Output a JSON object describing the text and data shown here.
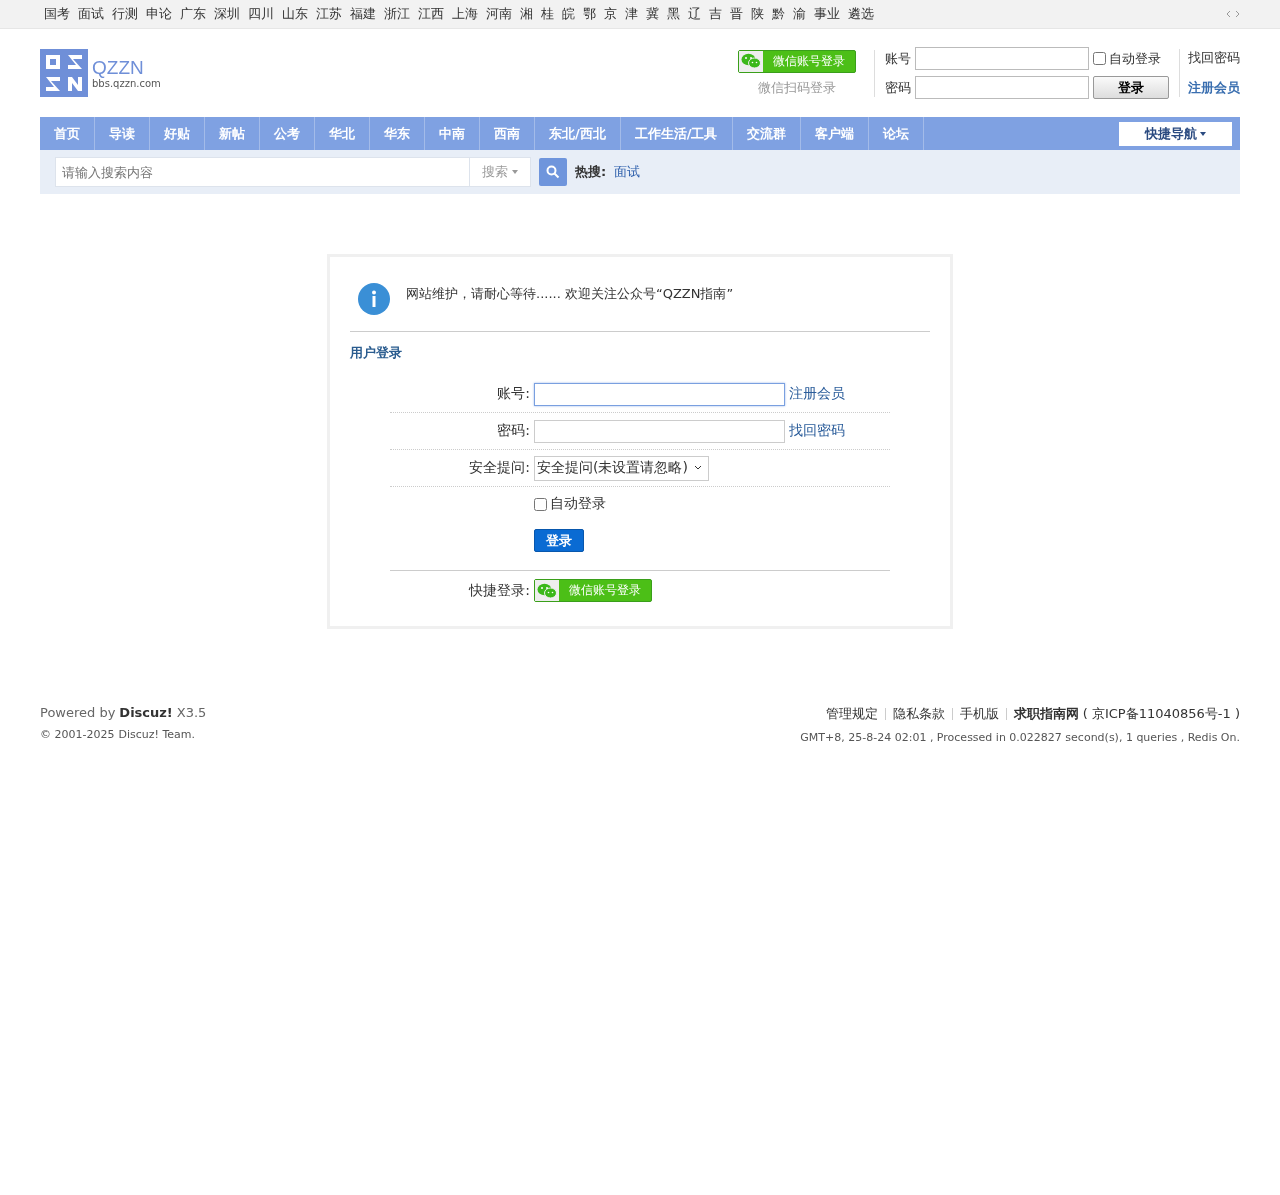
{
  "top_links": [
    "国考",
    "面试",
    "行测",
    "申论",
    "广东",
    "深圳",
    "四川",
    "山东",
    "江苏",
    "福建",
    "浙江",
    "江西",
    "上海",
    "河南",
    "湘",
    "桂",
    "皖",
    "鄂",
    "京",
    "津",
    "冀",
    "黑",
    "辽",
    "吉",
    "晋",
    "陕",
    "黔",
    "渝",
    "事业",
    "遴选"
  ],
  "logo": {
    "name": "QZZN",
    "domain": "bbs.qzzn.com"
  },
  "header_login": {
    "wechat_button": "微信账号登录",
    "wechat_hint": "微信扫码登录",
    "account_label": "账号",
    "password_label": "密码",
    "auto_login": {
      "label": "自动登录",
      "checked": false
    },
    "login_button": "登录",
    "forgot_link": "找回密码",
    "register_link": "注册会员"
  },
  "nav": {
    "items": [
      "首页",
      "导读",
      "好贴",
      "新帖",
      "公考",
      "华北",
      "华东",
      "中南",
      "西南",
      "东北/西北",
      "工作生活/工具",
      "交流群",
      "客户端",
      "论坛"
    ],
    "quick_nav": "快捷导航"
  },
  "search": {
    "placeholder": "请输入搜索内容",
    "type": "搜索",
    "hot_label": "热搜:",
    "hot_links": [
      "面试"
    ]
  },
  "notice": "网站维护，请耐心等待...... 欢迎关注公众号“QZZN指南”",
  "login_form": {
    "title": "用户登录",
    "rows": [
      {
        "kind": "input",
        "label": "账号:",
        "link": "注册会员",
        "focused": true
      },
      {
        "kind": "input",
        "label": "密码:",
        "link": "找回密码",
        "focused": false
      },
      {
        "kind": "select",
        "label": "安全提问:",
        "value": "安全提问(未设置请忽略)"
      }
    ],
    "auto_login": {
      "label": "自动登录",
      "checked": false
    },
    "login_button": "登录",
    "quick_label": "快捷登录:",
    "wechat_button": "微信账号登录"
  },
  "footer": {
    "powered": "Powered by",
    "brand": "Discuz!",
    "version": "X3.5",
    "copyright": "© 2001-2025",
    "team": "Discuz! Team.",
    "links": [
      "管理规定",
      "隐私条款",
      "手机版"
    ],
    "site": "求职指南网",
    "icp": "( 京ICP备11040856号-1 )",
    "stats": "GMT+8, 25-8-24 02:01 , Processed in 0.022827 second(s), 1 queries , Redis On."
  }
}
